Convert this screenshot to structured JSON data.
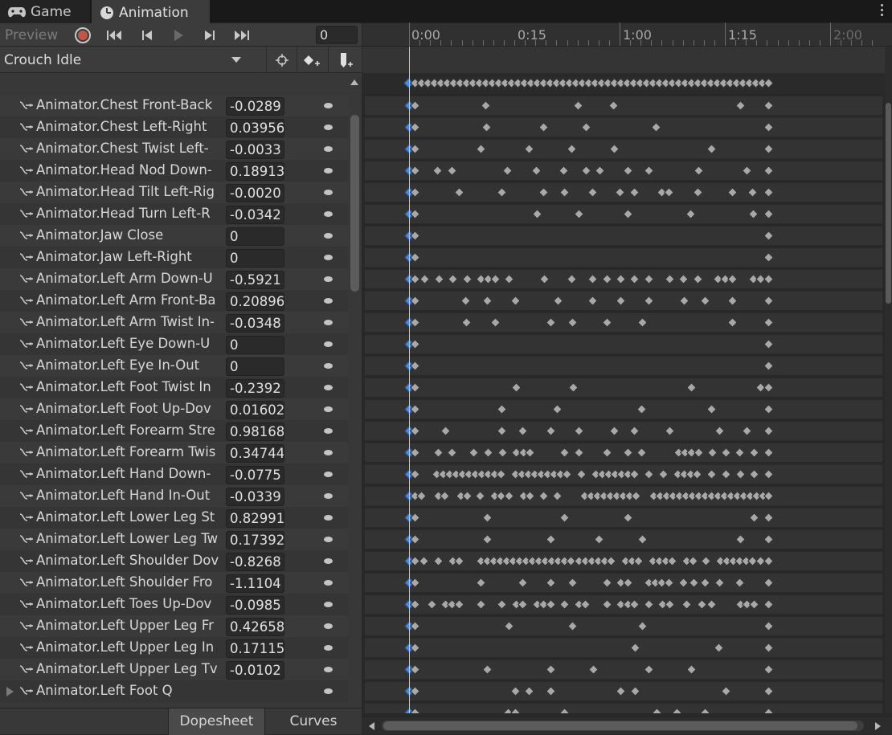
{
  "tabs": [
    {
      "label": "Game",
      "icon": "gamepad-icon"
    },
    {
      "label": "Animation",
      "icon": "clock-icon"
    }
  ],
  "toolbar": {
    "preview_label": "Preview",
    "frame_value": "0"
  },
  "clip": {
    "name": "Crouch Idle"
  },
  "timeline": {
    "labels": [
      "0:00",
      "0:15",
      "1:00",
      "1:15",
      "2:00"
    ]
  },
  "properties": [
    {
      "name": "Animator.Chest Front-Back",
      "value": "-0.0289"
    },
    {
      "name": "Animator.Chest Left-Right",
      "value": "0.03956"
    },
    {
      "name": "Animator.Chest Twist Left-",
      "value": "-0.0033"
    },
    {
      "name": "Animator.Head Nod Down-",
      "value": "0.18913"
    },
    {
      "name": "Animator.Head Tilt Left-Rig",
      "value": "-0.0020"
    },
    {
      "name": "Animator.Head Turn Left-R",
      "value": "-0.0342"
    },
    {
      "name": "Animator.Jaw Close",
      "value": "0"
    },
    {
      "name": "Animator.Jaw Left-Right",
      "value": "0"
    },
    {
      "name": "Animator.Left Arm Down-U",
      "value": "-0.5921"
    },
    {
      "name": "Animator.Left Arm Front-Ba",
      "value": "0.20896"
    },
    {
      "name": "Animator.Left Arm Twist In-",
      "value": "-0.0348"
    },
    {
      "name": "Animator.Left Eye Down-U",
      "value": "0"
    },
    {
      "name": "Animator.Left Eye In-Out",
      "value": "0"
    },
    {
      "name": "Animator.Left Foot Twist In",
      "value": "-0.2392"
    },
    {
      "name": "Animator.Left Foot Up-Dov",
      "value": "0.01602"
    },
    {
      "name": "Animator.Left Forearm Stre",
      "value": "0.98168"
    },
    {
      "name": "Animator.Left Forearm Twis",
      "value": "0.34744"
    },
    {
      "name": "Animator.Left Hand Down-",
      "value": "-0.0775"
    },
    {
      "name": "Animator.Left Hand In-Out",
      "value": "-0.0339"
    },
    {
      "name": "Animator.Left Lower Leg St",
      "value": "0.82991"
    },
    {
      "name": "Animator.Left Lower Leg Tw",
      "value": "0.17392"
    },
    {
      "name": "Animator.Left Shoulder Dov",
      "value": "-0.8268"
    },
    {
      "name": "Animator.Left Shoulder Fro",
      "value": "-1.1104"
    },
    {
      "name": "Animator.Left Toes Up-Dov",
      "value": "-0.0985"
    },
    {
      "name": "Animator.Left Upper Leg Fr",
      "value": "0.42658"
    },
    {
      "name": "Animator.Left Upper Leg In",
      "value": "0.17115"
    },
    {
      "name": "Animator.Left Upper Leg Tv",
      "value": "-0.0102"
    },
    {
      "name": "Animator.Left Foot Q",
      "value": ""
    }
  ],
  "bottom_tabs": [
    "Dopesheet",
    "Curves"
  ]
}
